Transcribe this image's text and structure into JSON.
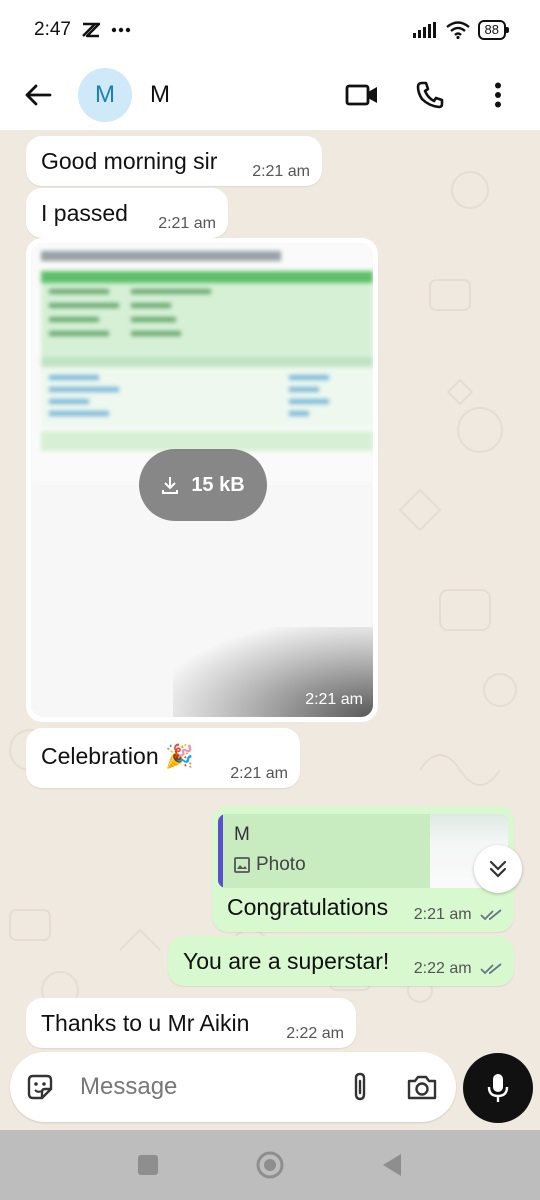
{
  "status_bar": {
    "time": "2:47",
    "battery": "88"
  },
  "header": {
    "avatar_letter": "M",
    "contact_name": "M"
  },
  "messages": [
    {
      "text": "Good morning sir",
      "time": "2:21 am"
    },
    {
      "text": "I passed",
      "time": "2:21 am"
    },
    {
      "image": {
        "download_size": "15 kB",
        "time": "2:21 am"
      }
    },
    {
      "text": "Celebration 🎉",
      "time": "2:21 am"
    },
    {
      "reply": {
        "name": "M",
        "type": "Photo"
      },
      "text": "Congratulations",
      "time": "2:21 am"
    },
    {
      "text": "You are a superstar!",
      "time": "2:22 am"
    },
    {
      "text": "Thanks to u Mr Aikin",
      "time": "2:22 am"
    }
  ],
  "composer": {
    "placeholder": "Message"
  },
  "colors": {
    "incoming_bubble": "#ffffff",
    "outgoing_bubble": "#d8f8cf",
    "chat_background": "#efe9df",
    "reply_accent": "#5a4fcf",
    "tick_color": "#667781"
  },
  "icons": {
    "back": "arrow-left-icon",
    "video": "video-call-icon",
    "call": "phone-icon",
    "menu": "more-vert-icon",
    "sticker": "sticker-icon",
    "attach": "paperclip-icon",
    "camera": "camera-icon",
    "mic": "mic-icon",
    "scroll": "double-chevron-down-icon"
  }
}
